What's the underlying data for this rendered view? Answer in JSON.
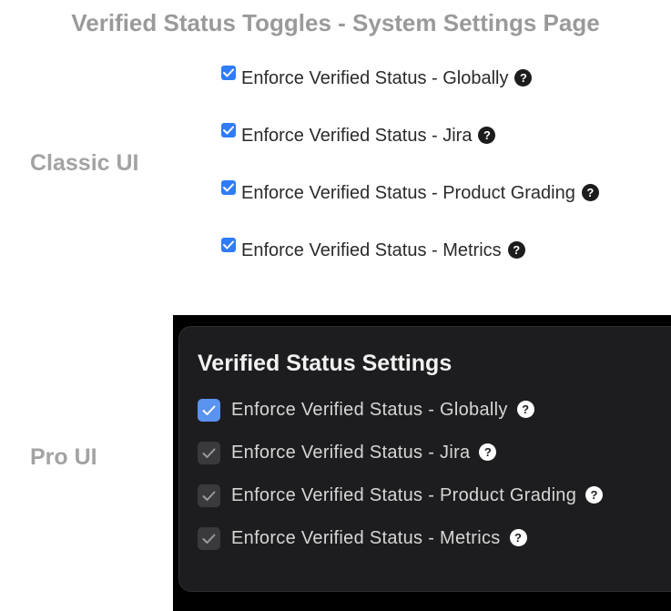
{
  "page_title": "Verified Status Toggles - System Settings Page",
  "classic": {
    "label": "Classic UI",
    "items": [
      {
        "label": "Enforce Verified Status - Globally",
        "checked": true,
        "help": "?"
      },
      {
        "label": "Enforce Verified Status - Jira",
        "checked": true,
        "help": "?"
      },
      {
        "label": "Enforce Verified Status - Product Grading",
        "checked": true,
        "help": "?"
      },
      {
        "label": "Enforce Verified Status - Metrics",
        "checked": true,
        "help": "?"
      }
    ]
  },
  "pro": {
    "label": "Pro UI",
    "panel_title": "Verified Status Settings",
    "items": [
      {
        "label": "Enforce Verified Status - Globally",
        "checked": true,
        "state": "active",
        "help": "?"
      },
      {
        "label": "Enforce Verified Status - Jira",
        "checked": true,
        "state": "muted",
        "help": "?"
      },
      {
        "label": "Enforce Verified Status - Product Grading",
        "checked": true,
        "state": "muted",
        "help": "?"
      },
      {
        "label": "Enforce Verified Status - Metrics",
        "checked": true,
        "state": "muted",
        "help": "?"
      }
    ]
  },
  "colors": {
    "classic_checkbox": "#2f7cf6",
    "pro_active_checkbox": "#5a93f0",
    "pro_muted_checkbox": "#3a3a3c",
    "pro_panel_bg": "#1d1d1f"
  },
  "icons": {
    "check": "checkmark-icon",
    "help": "question-circle-icon"
  }
}
